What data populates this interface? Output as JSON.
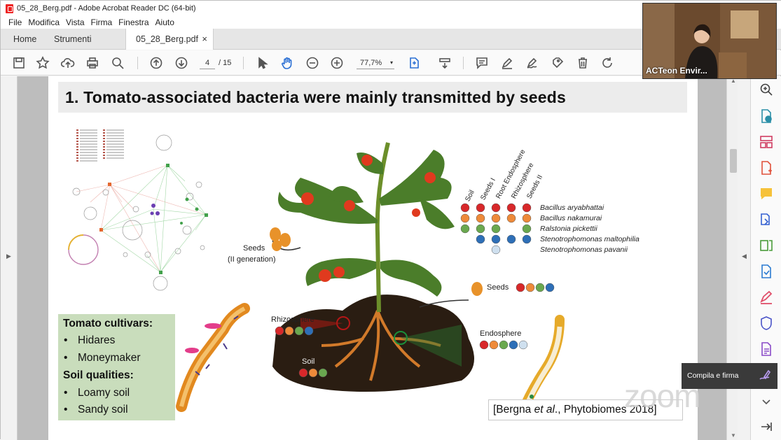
{
  "window": {
    "title": "05_28_Berg.pdf - Adobe Acrobat Reader DC (64-bit)"
  },
  "menu": [
    "File",
    "Modifica",
    "Vista",
    "Firma",
    "Finestra",
    "Aiuto"
  ],
  "tabs": {
    "home": "Home",
    "tools": "Strumenti",
    "doc": "05_28_Berg.pdf",
    "close": "×"
  },
  "toolbar": {
    "page_current": "4",
    "page_total": "/ 15",
    "zoom": "77,7%",
    "zoom_caret": "▾"
  },
  "video": {
    "name": "ACTeon Envir..."
  },
  "tooltip": {
    "label": "Compila e firma"
  },
  "watermark": "zoom",
  "slide": {
    "title": "1. Tomato-associated bacteria were mainly transmitted by seeds",
    "green_box": {
      "h1": "Tomato cultivars:",
      "c1": "Hidares",
      "c2": "Moneymaker",
      "h2": "Soil qualities:",
      "s1": "Loamy soil",
      "s2": "Sandy soil",
      "bullet": "•"
    },
    "labels": {
      "seeds2": "Seeds",
      "seeds2b": "(II generation)",
      "seeds": "Seeds",
      "rhizosphere": "Rhizosphere",
      "soil": "Soil",
      "endosphere": "Endosphere"
    },
    "columns": [
      "Soil",
      "Seeds I",
      "Root Endosphere",
      "Rhizosphere",
      "Seeds II"
    ],
    "species": [
      "Bacillus aryabhattai",
      "Bacillus nakamurai",
      "Ralstonia pickettii",
      "Stenotrophomonas maltophilia",
      "Stenotrophomonas pavanii"
    ],
    "citation": {
      "pre": "[Bergna ",
      "etal": "et al",
      "post": "., Phytobiomes 2018]"
    }
  },
  "colors": {
    "red": "#d8282a",
    "orange": "#ee8a3a",
    "green": "#6aa84f",
    "blue": "#2e6fb7",
    "lightblue": "#cfe0ef"
  }
}
